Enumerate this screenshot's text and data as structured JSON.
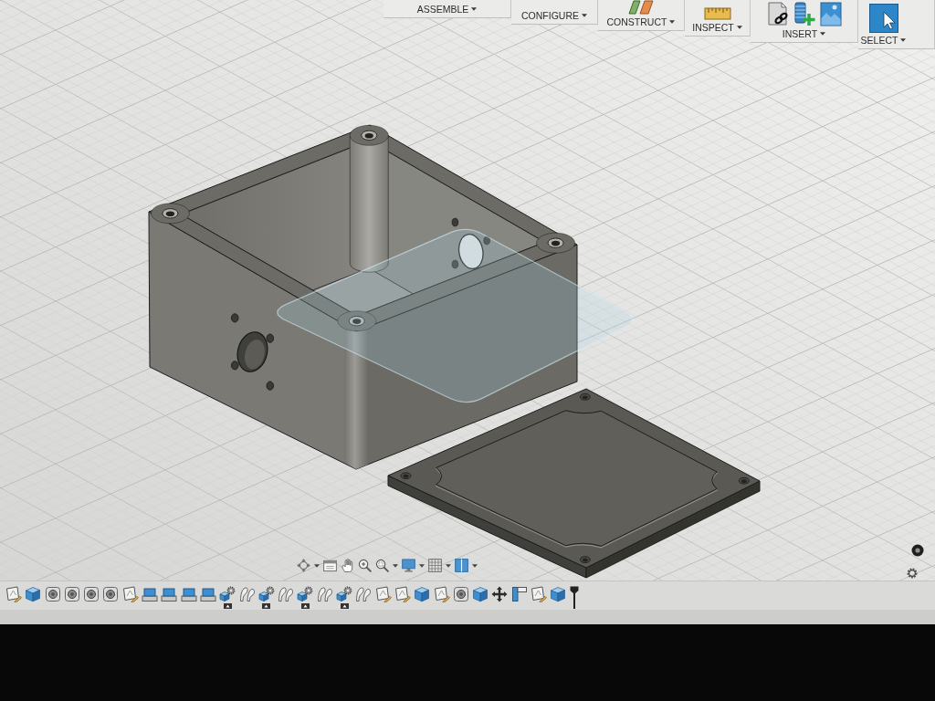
{
  "toolbar": {
    "groups": [
      {
        "label": "ASSEMBLE"
      },
      {
        "label": "CONFIGURE"
      },
      {
        "label": "CONSTRUCT"
      },
      {
        "label": "INSPECT"
      },
      {
        "label": "INSERT"
      },
      {
        "label": "SELECT"
      }
    ]
  },
  "timeline": {
    "features": [
      {
        "kind": "sketch"
      },
      {
        "kind": "extrude"
      },
      {
        "kind": "hole"
      },
      {
        "kind": "hole"
      },
      {
        "kind": "hole"
      },
      {
        "kind": "hole"
      },
      {
        "kind": "sketch"
      },
      {
        "kind": "slab"
      },
      {
        "kind": "slab"
      },
      {
        "kind": "slab"
      },
      {
        "kind": "slab"
      },
      {
        "kind": "pattern"
      },
      {
        "kind": "curves"
      },
      {
        "kind": "pattern"
      },
      {
        "kind": "curves"
      },
      {
        "kind": "pattern"
      },
      {
        "kind": "curves"
      },
      {
        "kind": "pattern"
      },
      {
        "kind": "curves"
      },
      {
        "kind": "sketch"
      },
      {
        "kind": "sketch"
      },
      {
        "kind": "extrude"
      },
      {
        "kind": "sketch"
      },
      {
        "kind": "hole"
      },
      {
        "kind": "extrude"
      },
      {
        "kind": "move"
      },
      {
        "kind": "corner"
      },
      {
        "kind": "sketch"
      },
      {
        "kind": "extrude"
      }
    ]
  }
}
